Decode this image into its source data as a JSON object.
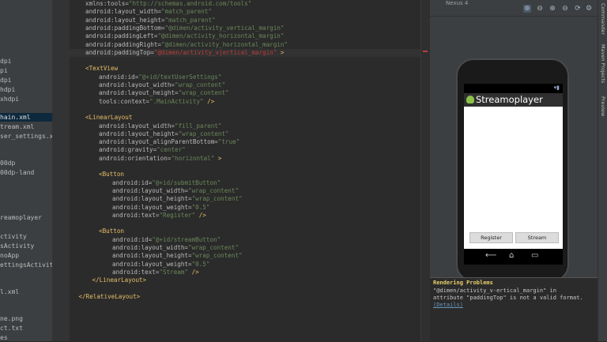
{
  "project_tree": {
    "items": [
      {
        "label": "dpi"
      },
      {
        "label": "pi"
      },
      {
        "label": "dpi"
      },
      {
        "label": "hdpi"
      },
      {
        "label": "xhdpi"
      },
      {
        "label": "hain.xml"
      },
      {
        "label": "tream.xml"
      },
      {
        "label": "ser_settings.xml"
      },
      {
        "label": "00dp"
      },
      {
        "label": "00dp-land"
      },
      {
        "label": "reamoplayer"
      },
      {
        "label": "ctivity"
      },
      {
        "label": "sActivity"
      },
      {
        "label": "noApp"
      },
      {
        "label": "ettingsActivity"
      },
      {
        "label": "l.xml"
      },
      {
        "label": "ne.png"
      },
      {
        "label": "ct.txt"
      },
      {
        "label": "es"
      }
    ]
  },
  "editor": {
    "lines": [
      {
        "indent": 0,
        "parts": [
          {
            "t": "attr",
            "v": "xmlns:tools="
          },
          {
            "t": "str",
            "v": "\"http://schemas.android.com/tools\""
          }
        ]
      },
      {
        "indent": 0,
        "parts": [
          {
            "t": "attr",
            "v": "android:layout_width="
          },
          {
            "t": "str",
            "v": "\"match_parent\""
          }
        ]
      },
      {
        "indent": 0,
        "parts": [
          {
            "t": "attr",
            "v": "android:layout_height="
          },
          {
            "t": "str",
            "v": "\"match_parent\""
          }
        ]
      },
      {
        "indent": 0,
        "parts": [
          {
            "t": "attr",
            "v": "android:paddingBottom="
          },
          {
            "t": "str",
            "v": "\"@dimen/activity_vertical_margin\""
          }
        ]
      },
      {
        "indent": 0,
        "parts": [
          {
            "t": "attr",
            "v": "android:paddingLeft="
          },
          {
            "t": "str",
            "v": "\"@dimen/activity_horizontal_margin\""
          }
        ]
      },
      {
        "indent": 0,
        "parts": [
          {
            "t": "attr",
            "v": "android:paddingRight="
          },
          {
            "t": "str",
            "v": "\"@dimen/activity_horizontal_margin\""
          }
        ]
      },
      {
        "indent": 0,
        "hl": true,
        "parts": [
          {
            "t": "attr",
            "v": "android:paddingTop="
          },
          {
            "t": "err",
            "v": "\"@dimen/activity_v|ertical_margin\""
          },
          {
            "t": "tag",
            "v": " >"
          }
        ]
      },
      {
        "indent": 0,
        "parts": []
      },
      {
        "indent": 0,
        "parts": [
          {
            "t": "tag",
            "v": "<TextView"
          }
        ]
      },
      {
        "indent": 2,
        "parts": [
          {
            "t": "attr",
            "v": "android:id="
          },
          {
            "t": "str",
            "v": "\"@+id/textUserSettings\""
          }
        ]
      },
      {
        "indent": 2,
        "parts": [
          {
            "t": "attr",
            "v": "android:layout_width="
          },
          {
            "t": "str",
            "v": "\"wrap_content\""
          }
        ]
      },
      {
        "indent": 2,
        "parts": [
          {
            "t": "attr",
            "v": "android:layout_height="
          },
          {
            "t": "str",
            "v": "\"wrap_content\""
          }
        ]
      },
      {
        "indent": 2,
        "parts": [
          {
            "t": "attr",
            "v": "tools:context="
          },
          {
            "t": "str",
            "v": "\".MainActivity\""
          },
          {
            "t": "tag",
            "v": " />"
          }
        ]
      },
      {
        "indent": 0,
        "parts": []
      },
      {
        "indent": 0,
        "parts": [
          {
            "t": "tag",
            "v": "<LinearLayout"
          }
        ]
      },
      {
        "indent": 2,
        "parts": [
          {
            "t": "attr",
            "v": "android:layout_width="
          },
          {
            "t": "str",
            "v": "\"fill_parent\""
          }
        ]
      },
      {
        "indent": 2,
        "parts": [
          {
            "t": "attr",
            "v": "android:layout_height="
          },
          {
            "t": "str",
            "v": "\"wrap_content\""
          }
        ]
      },
      {
        "indent": 2,
        "parts": [
          {
            "t": "attr",
            "v": "android:layout_alignParentBottom="
          },
          {
            "t": "str",
            "v": "\"true\""
          }
        ]
      },
      {
        "indent": 2,
        "parts": [
          {
            "t": "attr",
            "v": "android:gravity="
          },
          {
            "t": "str",
            "v": "\"center\""
          }
        ]
      },
      {
        "indent": 2,
        "parts": [
          {
            "t": "attr",
            "v": "android:orientation="
          },
          {
            "t": "str",
            "v": "\"horizontal\""
          },
          {
            "t": "tag",
            "v": " >"
          }
        ]
      },
      {
        "indent": 0,
        "parts": []
      },
      {
        "indent": 2,
        "parts": [
          {
            "t": "tag",
            "v": "<Button"
          }
        ]
      },
      {
        "indent": 4,
        "parts": [
          {
            "t": "attr",
            "v": "android:id="
          },
          {
            "t": "str",
            "v": "\"@+id/submitButton\""
          }
        ]
      },
      {
        "indent": 4,
        "parts": [
          {
            "t": "attr",
            "v": "android:layout_width="
          },
          {
            "t": "str",
            "v": "\"wrap_content\""
          }
        ]
      },
      {
        "indent": 4,
        "parts": [
          {
            "t": "attr",
            "v": "android:layout_height="
          },
          {
            "t": "str",
            "v": "\"wrap_content\""
          }
        ]
      },
      {
        "indent": 4,
        "parts": [
          {
            "t": "attr",
            "v": "android:layout_weight="
          },
          {
            "t": "str",
            "v": "\"0.5\""
          }
        ]
      },
      {
        "indent": 4,
        "parts": [
          {
            "t": "attr",
            "v": "android:text="
          },
          {
            "t": "str",
            "v": "\"Register\""
          },
          {
            "t": "tag",
            "v": " />"
          }
        ]
      },
      {
        "indent": 0,
        "parts": []
      },
      {
        "indent": 2,
        "parts": [
          {
            "t": "tag",
            "v": "<Button"
          }
        ]
      },
      {
        "indent": 4,
        "parts": [
          {
            "t": "attr",
            "v": "android:id="
          },
          {
            "t": "str",
            "v": "\"@+id/streamButton\""
          }
        ]
      },
      {
        "indent": 4,
        "parts": [
          {
            "t": "attr",
            "v": "android:layout_width="
          },
          {
            "t": "str",
            "v": "\"wrap_content\""
          }
        ]
      },
      {
        "indent": 4,
        "parts": [
          {
            "t": "attr",
            "v": "android:layout_height="
          },
          {
            "t": "str",
            "v": "\"wrap_content\""
          }
        ]
      },
      {
        "indent": 4,
        "parts": [
          {
            "t": "attr",
            "v": "android:layout_weight="
          },
          {
            "t": "str",
            "v": "\"0.5\""
          }
        ]
      },
      {
        "indent": 4,
        "parts": [
          {
            "t": "attr",
            "v": "android:text="
          },
          {
            "t": "str",
            "v": "\"Stream\""
          },
          {
            "t": "tag",
            "v": " />"
          }
        ]
      },
      {
        "indent": 1,
        "parts": [
          {
            "t": "tag",
            "v": "</LinearLayout>"
          }
        ]
      },
      {
        "indent": 0,
        "parts": []
      },
      {
        "indent": -1,
        "parts": [
          {
            "t": "tag",
            "v": "</RelativeLayout>"
          }
        ]
      }
    ]
  },
  "preview": {
    "toolbar_label": "Nexus 4",
    "app_title": "Streamoplayer",
    "register_label": "Register",
    "stream_label": "Stream",
    "nav_back": "⟵",
    "nav_home": "⌂",
    "nav_recent": "▭"
  },
  "problems": {
    "title": "Rendering Problems",
    "line1": "\"@dimen/activity_v-ertical_margin\" in",
    "line2": "attribute \"paddingTop\" is not a valid format.",
    "link": "(Details)"
  },
  "right_strip": {
    "tab1": "Commander",
    "tab2": "Maven Projects",
    "tab3": "Preview"
  },
  "colors": {
    "tag": "#e8bf6a",
    "string": "#6a8759",
    "error": "#bc3f3c",
    "app_icon": "#8bc34a"
  }
}
